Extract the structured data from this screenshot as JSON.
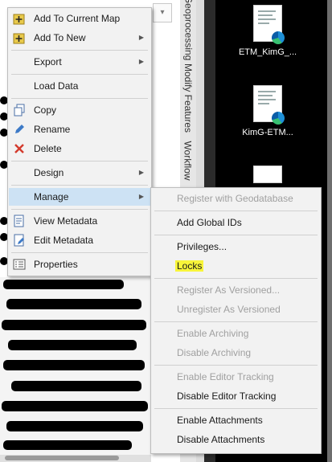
{
  "side_tabs": [
    "Geoprocessing",
    "Modify Features",
    "Workflow"
  ],
  "desktop_icons": [
    {
      "label": "ETM_KimG_..."
    },
    {
      "label": "KimG-ETM..."
    }
  ],
  "context_menu": {
    "items": [
      {
        "label": "Add To Current Map",
        "icon": "add-data-icon",
        "has_submenu": false
      },
      {
        "label": "Add To New",
        "icon": "add-data-icon",
        "has_submenu": true
      },
      {
        "label": "Export",
        "has_submenu": true
      },
      {
        "label": "Load Data",
        "has_submenu": false
      },
      {
        "label": "Copy",
        "icon": "copy-icon",
        "has_submenu": false
      },
      {
        "label": "Rename",
        "icon": "pencil-icon",
        "has_submenu": false
      },
      {
        "label": "Delete",
        "icon": "delete-x-icon",
        "has_submenu": false
      },
      {
        "label": "Design",
        "has_submenu": true
      },
      {
        "label": "Manage",
        "has_submenu": true,
        "highlighted": true
      },
      {
        "label": "View Metadata",
        "icon": "metadata-icon",
        "has_submenu": false
      },
      {
        "label": "Edit Metadata",
        "icon": "edit-metadata-icon",
        "has_submenu": false
      },
      {
        "label": "Properties",
        "icon": "properties-icon",
        "has_submenu": false
      }
    ]
  },
  "manage_submenu": {
    "items": [
      {
        "label": "Register with Geodatabase",
        "enabled": false
      },
      {
        "label": "Add Global IDs",
        "enabled": true
      },
      {
        "label": "Privileges...",
        "enabled": true
      },
      {
        "label": "Locks",
        "enabled": true,
        "highlight_color": "#f8f53a"
      },
      {
        "label": "Register As Versioned...",
        "enabled": false
      },
      {
        "label": "Unregister As Versioned",
        "enabled": false
      },
      {
        "label": "Enable Archiving",
        "enabled": false
      },
      {
        "label": "Disable Archiving",
        "enabled": false
      },
      {
        "label": "Enable Editor Tracking",
        "enabled": false
      },
      {
        "label": "Disable Editor Tracking",
        "enabled": true
      },
      {
        "label": "Enable Attachments",
        "enabled": true
      },
      {
        "label": "Disable Attachments",
        "enabled": true
      }
    ]
  },
  "colors": {
    "menu_bg": "#f2f2f2",
    "hover": "#cde2f4",
    "disabled_text": "#a0a0a0",
    "desktop": "#000000"
  }
}
